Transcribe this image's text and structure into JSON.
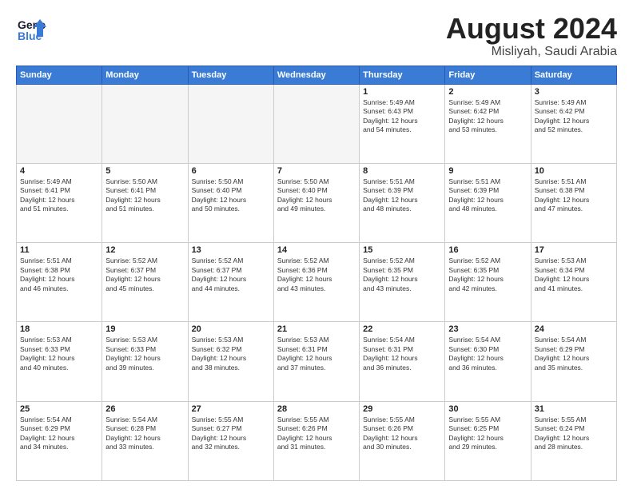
{
  "header": {
    "logo_line1": "General",
    "logo_line2": "Blue",
    "month": "August 2024",
    "location": "Misliyah, Saudi Arabia"
  },
  "weekdays": [
    "Sunday",
    "Monday",
    "Tuesday",
    "Wednesday",
    "Thursday",
    "Friday",
    "Saturday"
  ],
  "weeks": [
    [
      {
        "day": "",
        "info": ""
      },
      {
        "day": "",
        "info": ""
      },
      {
        "day": "",
        "info": ""
      },
      {
        "day": "",
        "info": ""
      },
      {
        "day": "1",
        "info": "Sunrise: 5:49 AM\nSunset: 6:43 PM\nDaylight: 12 hours\nand 54 minutes."
      },
      {
        "day": "2",
        "info": "Sunrise: 5:49 AM\nSunset: 6:42 PM\nDaylight: 12 hours\nand 53 minutes."
      },
      {
        "day": "3",
        "info": "Sunrise: 5:49 AM\nSunset: 6:42 PM\nDaylight: 12 hours\nand 52 minutes."
      }
    ],
    [
      {
        "day": "4",
        "info": "Sunrise: 5:49 AM\nSunset: 6:41 PM\nDaylight: 12 hours\nand 51 minutes."
      },
      {
        "day": "5",
        "info": "Sunrise: 5:50 AM\nSunset: 6:41 PM\nDaylight: 12 hours\nand 51 minutes."
      },
      {
        "day": "6",
        "info": "Sunrise: 5:50 AM\nSunset: 6:40 PM\nDaylight: 12 hours\nand 50 minutes."
      },
      {
        "day": "7",
        "info": "Sunrise: 5:50 AM\nSunset: 6:40 PM\nDaylight: 12 hours\nand 49 minutes."
      },
      {
        "day": "8",
        "info": "Sunrise: 5:51 AM\nSunset: 6:39 PM\nDaylight: 12 hours\nand 48 minutes."
      },
      {
        "day": "9",
        "info": "Sunrise: 5:51 AM\nSunset: 6:39 PM\nDaylight: 12 hours\nand 48 minutes."
      },
      {
        "day": "10",
        "info": "Sunrise: 5:51 AM\nSunset: 6:38 PM\nDaylight: 12 hours\nand 47 minutes."
      }
    ],
    [
      {
        "day": "11",
        "info": "Sunrise: 5:51 AM\nSunset: 6:38 PM\nDaylight: 12 hours\nand 46 minutes."
      },
      {
        "day": "12",
        "info": "Sunrise: 5:52 AM\nSunset: 6:37 PM\nDaylight: 12 hours\nand 45 minutes."
      },
      {
        "day": "13",
        "info": "Sunrise: 5:52 AM\nSunset: 6:37 PM\nDaylight: 12 hours\nand 44 minutes."
      },
      {
        "day": "14",
        "info": "Sunrise: 5:52 AM\nSunset: 6:36 PM\nDaylight: 12 hours\nand 43 minutes."
      },
      {
        "day": "15",
        "info": "Sunrise: 5:52 AM\nSunset: 6:35 PM\nDaylight: 12 hours\nand 43 minutes."
      },
      {
        "day": "16",
        "info": "Sunrise: 5:52 AM\nSunset: 6:35 PM\nDaylight: 12 hours\nand 42 minutes."
      },
      {
        "day": "17",
        "info": "Sunrise: 5:53 AM\nSunset: 6:34 PM\nDaylight: 12 hours\nand 41 minutes."
      }
    ],
    [
      {
        "day": "18",
        "info": "Sunrise: 5:53 AM\nSunset: 6:33 PM\nDaylight: 12 hours\nand 40 minutes."
      },
      {
        "day": "19",
        "info": "Sunrise: 5:53 AM\nSunset: 6:33 PM\nDaylight: 12 hours\nand 39 minutes."
      },
      {
        "day": "20",
        "info": "Sunrise: 5:53 AM\nSunset: 6:32 PM\nDaylight: 12 hours\nand 38 minutes."
      },
      {
        "day": "21",
        "info": "Sunrise: 5:53 AM\nSunset: 6:31 PM\nDaylight: 12 hours\nand 37 minutes."
      },
      {
        "day": "22",
        "info": "Sunrise: 5:54 AM\nSunset: 6:31 PM\nDaylight: 12 hours\nand 36 minutes."
      },
      {
        "day": "23",
        "info": "Sunrise: 5:54 AM\nSunset: 6:30 PM\nDaylight: 12 hours\nand 36 minutes."
      },
      {
        "day": "24",
        "info": "Sunrise: 5:54 AM\nSunset: 6:29 PM\nDaylight: 12 hours\nand 35 minutes."
      }
    ],
    [
      {
        "day": "25",
        "info": "Sunrise: 5:54 AM\nSunset: 6:29 PM\nDaylight: 12 hours\nand 34 minutes."
      },
      {
        "day": "26",
        "info": "Sunrise: 5:54 AM\nSunset: 6:28 PM\nDaylight: 12 hours\nand 33 minutes."
      },
      {
        "day": "27",
        "info": "Sunrise: 5:55 AM\nSunset: 6:27 PM\nDaylight: 12 hours\nand 32 minutes."
      },
      {
        "day": "28",
        "info": "Sunrise: 5:55 AM\nSunset: 6:26 PM\nDaylight: 12 hours\nand 31 minutes."
      },
      {
        "day": "29",
        "info": "Sunrise: 5:55 AM\nSunset: 6:26 PM\nDaylight: 12 hours\nand 30 minutes."
      },
      {
        "day": "30",
        "info": "Sunrise: 5:55 AM\nSunset: 6:25 PM\nDaylight: 12 hours\nand 29 minutes."
      },
      {
        "day": "31",
        "info": "Sunrise: 5:55 AM\nSunset: 6:24 PM\nDaylight: 12 hours\nand 28 minutes."
      }
    ]
  ]
}
